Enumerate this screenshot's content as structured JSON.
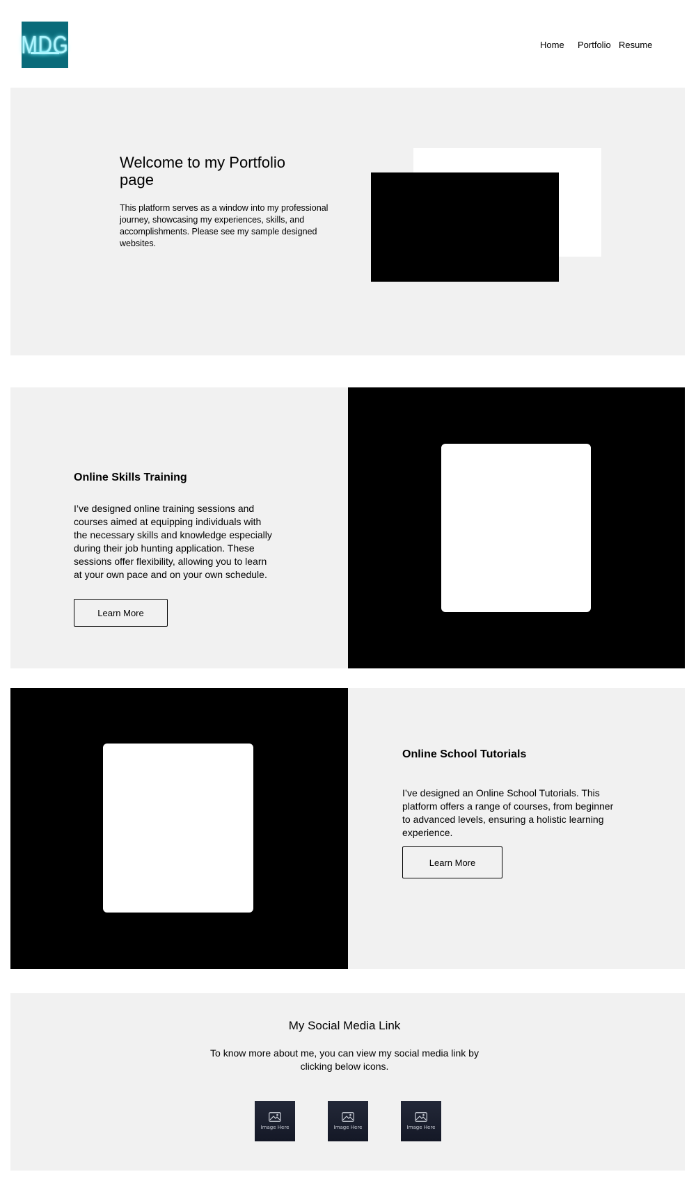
{
  "header": {
    "logo_text": "MDG",
    "logo_color": "#0a6b7a",
    "nav": [
      {
        "label": "Home"
      },
      {
        "label": "Portfolio"
      },
      {
        "label": "Resume"
      }
    ]
  },
  "hero": {
    "title": "Welcome to my Portfolio page",
    "text": "This platform serves as a window into my professional journey, showcasing my experiences, skills, and accomplishments. Please see my sample designed websites."
  },
  "skills": {
    "title": "Online Skills Training",
    "text": "I’ve designed online training sessions and courses aimed at equipping individuals with the necessary skills and knowledge especially during their job hunting application. These sessions offer flexibility, allowing you to learn at your own pace and on your own schedule.",
    "button_label": "Learn More"
  },
  "tutorials": {
    "title": "Online School Tutorials",
    "text": "I’ve designed an Online School Tutorials. This platform offers a range of courses, from beginner to advanced levels, ensuring a holistic learning experience.",
    "button_label": "Learn More"
  },
  "social": {
    "title": "My Social Media Link",
    "text": "To know more about me, you can view my social media link  by clicking below icons.",
    "icons": [
      {
        "caption": "Image Here",
        "icon": "image-placeholder-icon"
      },
      {
        "caption": "Image Here",
        "icon": "image-placeholder-icon"
      },
      {
        "caption": "Image Here",
        "icon": "image-placeholder-icon"
      }
    ]
  },
  "colors": {
    "panel_grey": "#f1f1f1",
    "panel_black": "#000000",
    "icon_tile": "#1b2030"
  }
}
